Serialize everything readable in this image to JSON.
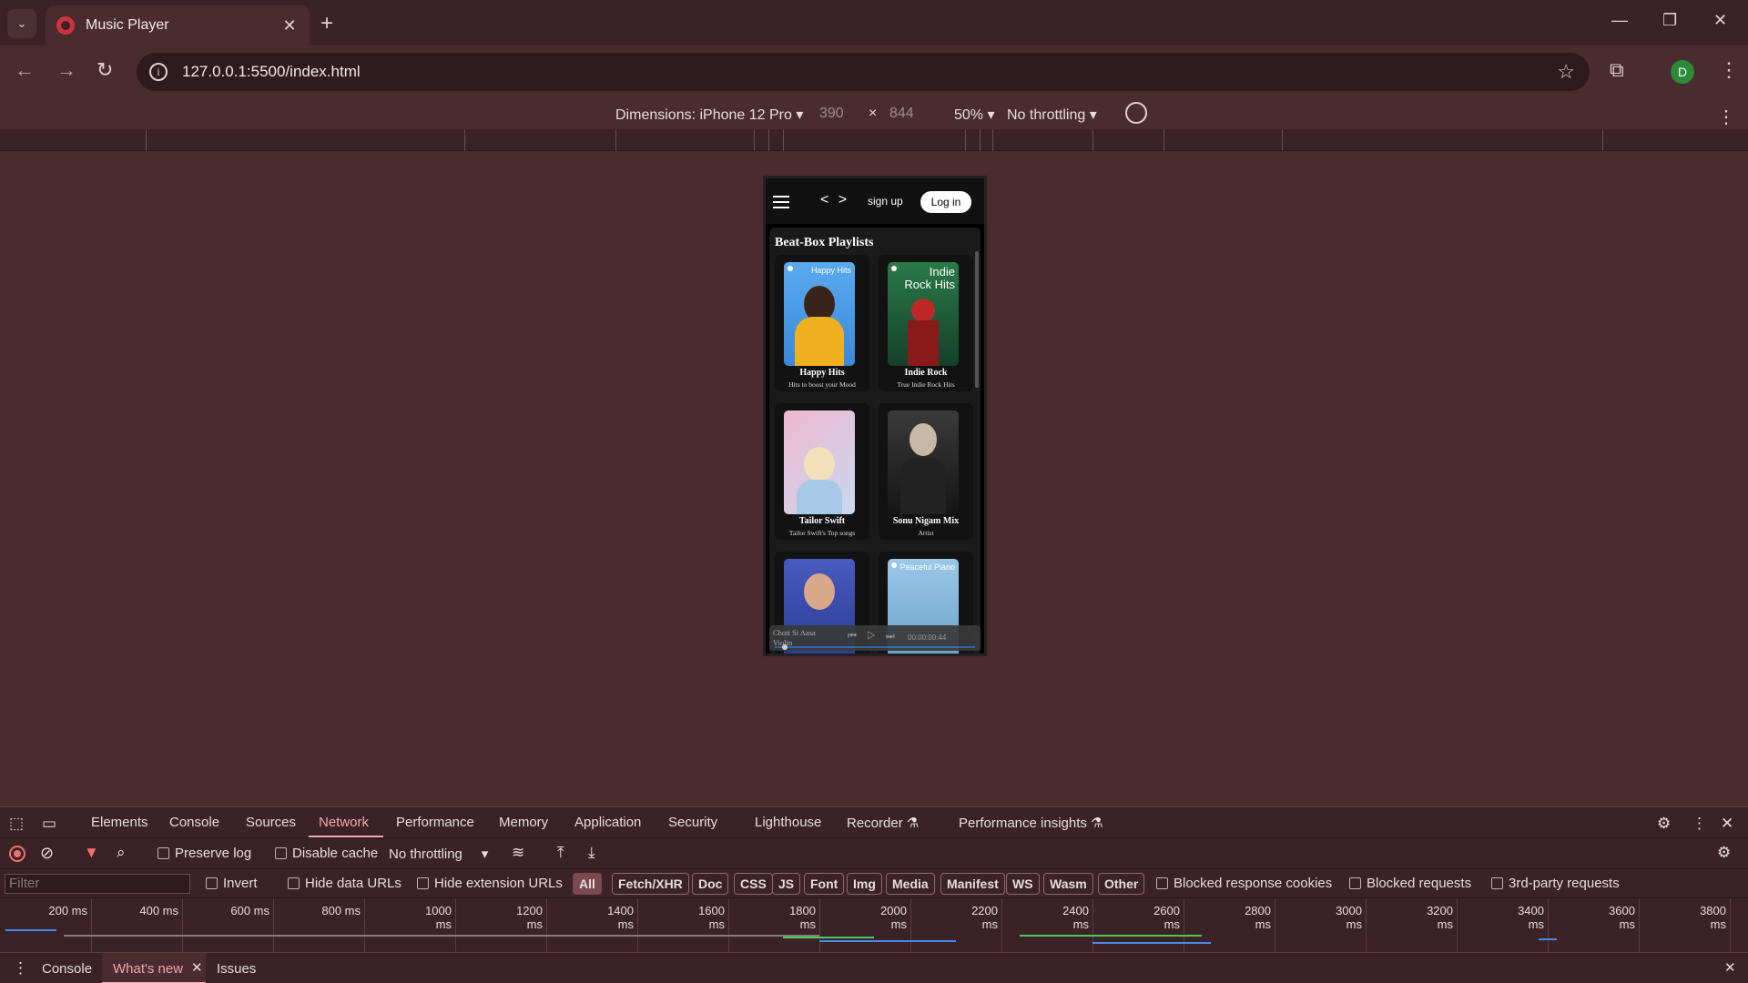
{
  "browser": {
    "tab_title": "Music Player",
    "url": "127.0.0.1:5500/index.html",
    "profile_initial": "D"
  },
  "device_toolbar": {
    "dimensions_label": "Dimensions: iPhone 12 Pro",
    "width": "390",
    "times": "×",
    "height": "844",
    "zoom": "50%",
    "throttling": "No throttling"
  },
  "app": {
    "nav_arrows": "< >",
    "signup_label": "sign up",
    "login_label": "Log in",
    "section_title": "Beat-Box Playlists",
    "playlists": [
      {
        "name": "Happy Hits",
        "subtitle": "Hits to boost your Mood",
        "cover_caption": "Happy Hits"
      },
      {
        "name": "Indie Rock",
        "subtitle": "True Indie Rock Hits",
        "cover_caption": "Indie Rock Hits"
      },
      {
        "name": "Tailor Swift",
        "subtitle": "Tailor Swift's Top songs",
        "cover_caption": ""
      },
      {
        "name": "Sonu Nigam Mix",
        "subtitle": "Artist",
        "cover_caption": ""
      },
      {
        "name": "",
        "subtitle": "",
        "cover_caption": ""
      },
      {
        "name": "",
        "subtitle": "",
        "cover_caption": "Peaceful Piano"
      }
    ],
    "player": {
      "song": "Choti Si Aasa Violin",
      "controls": "⏮ ▷ ⏭",
      "time": "00:00:00:44"
    },
    "colors": {
      "cover1": "#4a9ee8",
      "cover2": "#1e6b40",
      "cover3": "#e8a8c8",
      "cover4": "#2a2a2a",
      "cover5": "#3a4ab0",
      "cover6": "#8ab8d8"
    }
  },
  "devtools": {
    "tabs": [
      "Elements",
      "Console",
      "Sources",
      "Network",
      "Performance",
      "Memory",
      "Application",
      "Security",
      "Lighthouse",
      "Recorder ⚗",
      "Performance insights ⚗"
    ],
    "active_tab": "Network",
    "network": {
      "preserve_log": "Preserve log",
      "disable_cache": "Disable cache",
      "throttling": "No throttling",
      "filter_placeholder": "Filter",
      "invert": "Invert",
      "hide_data_urls": "Hide data URLs",
      "hide_extension_urls": "Hide extension URLs",
      "types": [
        "All",
        "Fetch/XHR",
        "Doc",
        "CSS",
        "JS",
        "Font",
        "Img",
        "Media",
        "Manifest",
        "WS",
        "Wasm",
        "Other"
      ],
      "blocked_cookies": "Blocked response cookies",
      "blocked_requests": "Blocked requests",
      "third_party": "3rd-party requests",
      "timeline_ticks": [
        "200 ms",
        "400 ms",
        "600 ms",
        "800 ms",
        "1000 ms",
        "1200 ms",
        "1400 ms",
        "1600 ms",
        "1800 ms",
        "2000 ms",
        "2200 ms",
        "2400 ms",
        "2600 ms",
        "2800 ms",
        "3000 ms",
        "3200 ms",
        "3400 ms",
        "3600 ms",
        "3800 ms"
      ]
    },
    "drawer_tabs": [
      "Console",
      "What's new",
      "Issues"
    ]
  }
}
